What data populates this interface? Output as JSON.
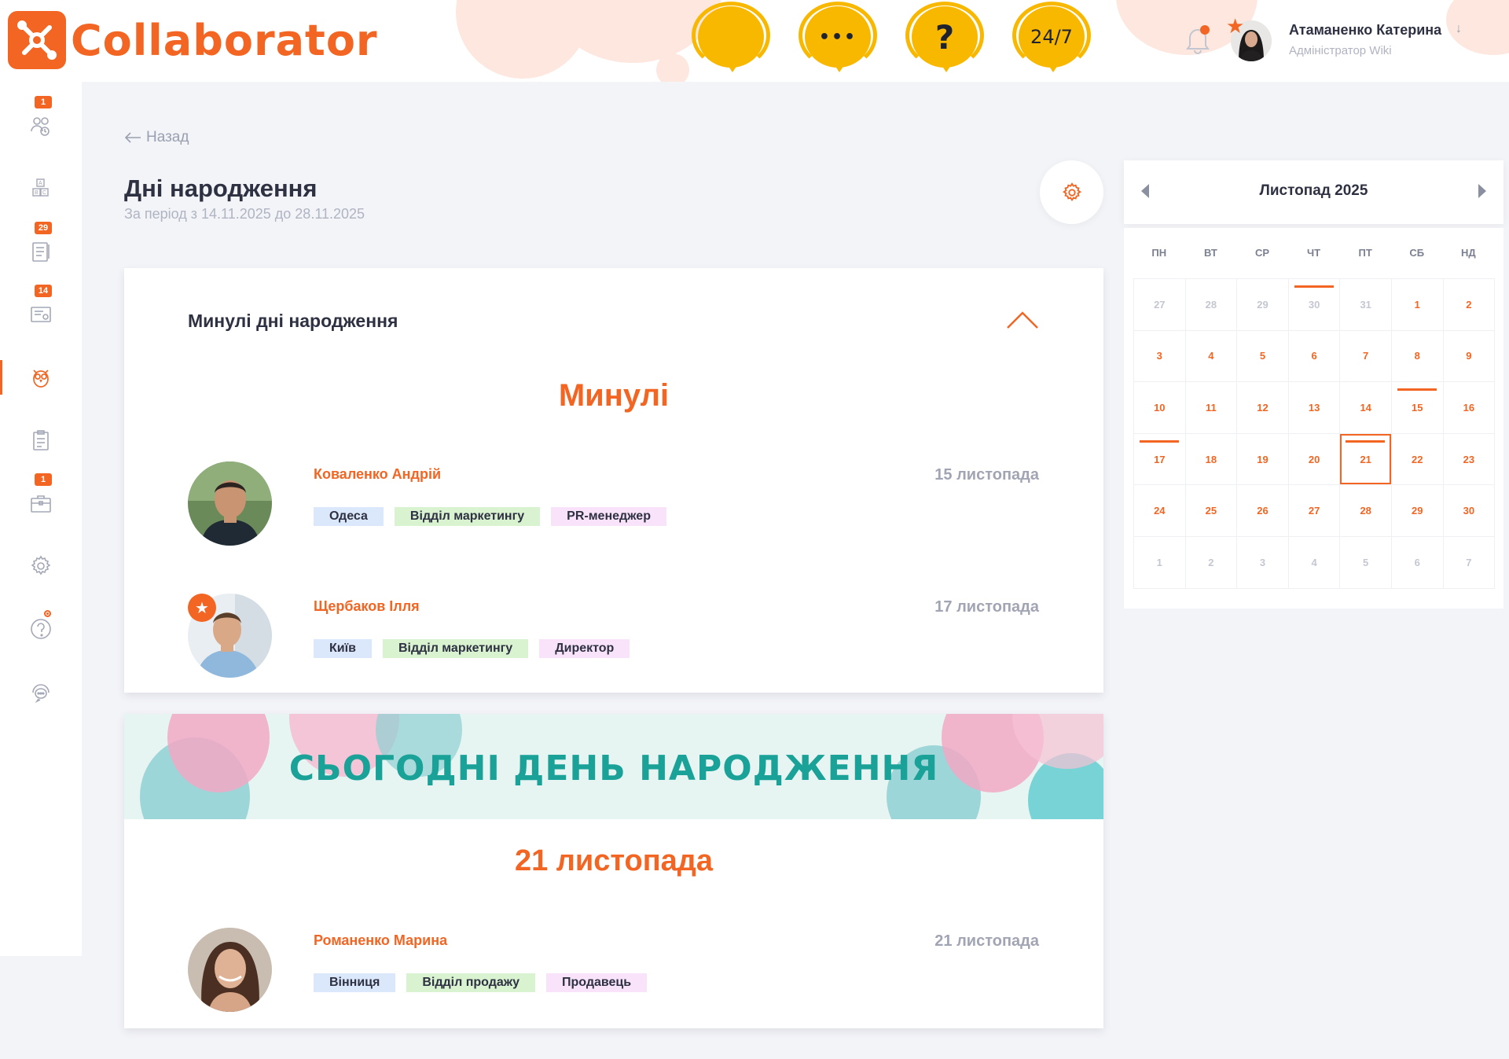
{
  "app": {
    "brand": "Collaborator",
    "accent": "#f26522"
  },
  "support": {
    "icons": [
      "support-chat-icon",
      "support-messenger-icon",
      "support-faq-icon",
      "support-24-7-icon"
    ],
    "label_247": "24/7",
    "label_faq": "?",
    "label_dots": "•••"
  },
  "user": {
    "name": "Атаманенко Катерина",
    "role": "Адміністратор Wiki",
    "caret": "↓"
  },
  "sidebar": {
    "items": [
      {
        "name": "users-icon",
        "badge": "1"
      },
      {
        "name": "abc-knowledge-icon",
        "badge": ""
      },
      {
        "name": "notebook-icon",
        "badge": "29"
      },
      {
        "name": "certificate-icon",
        "badge": "14"
      },
      {
        "name": "owl-icon",
        "badge": ""
      },
      {
        "name": "clipboard-icon",
        "badge": ""
      },
      {
        "name": "briefcase-icon",
        "badge": "1"
      },
      {
        "name": "gear-icon",
        "badge": ""
      },
      {
        "name": "help-icon",
        "badge": ""
      },
      {
        "name": "support-icon",
        "badge": ""
      }
    ]
  },
  "main": {
    "back": "Назад",
    "title": "Дні народження",
    "subtitle": "За період з 14.11.2025 до 28.11.2025"
  },
  "past": {
    "header": "Минулі дні народження",
    "title": "Минулі",
    "people": [
      {
        "name": "Коваленко Андрій",
        "date": "15 листопада",
        "city": "Одеса",
        "dept": "Відділ маркетингу",
        "role": "PR-менеджер"
      },
      {
        "name": "Щербаков Ілля",
        "date": "17 листопада",
        "city": "Київ",
        "dept": "Відділ маркетингу",
        "role": "Директор",
        "star": "★"
      }
    ]
  },
  "today": {
    "banner": "СЬОГОДНІ ДЕНЬ НАРОДЖЕННЯ",
    "date_title": "21 листопада",
    "people": [
      {
        "name": "Романенко Марина",
        "date": "21 листопада",
        "city": "Вінниця",
        "dept": "Відділ продажу",
        "role": "Продавець"
      }
    ]
  },
  "calendar": {
    "month": "Листопад 2025",
    "weekdays": [
      "ПН",
      "ВТ",
      "СР",
      "ЧТ",
      "ПТ",
      "СБ",
      "НД"
    ],
    "weeks": [
      [
        "27",
        "28",
        "29",
        "30",
        "31",
        "1",
        "2"
      ],
      [
        "3",
        "4",
        "5",
        "6",
        "7",
        "8",
        "9"
      ],
      [
        "10",
        "11",
        "12",
        "13",
        "14",
        "15",
        "16"
      ],
      [
        "17",
        "18",
        "19",
        "20",
        "21",
        "22",
        "23"
      ],
      [
        "24",
        "25",
        "26",
        "27",
        "28",
        "29",
        "30"
      ],
      [
        "1",
        "2",
        "3",
        "4",
        "5",
        "6",
        "7"
      ]
    ],
    "today": "21",
    "marked_days": [
      "30",
      "15",
      "17",
      "21"
    ]
  }
}
